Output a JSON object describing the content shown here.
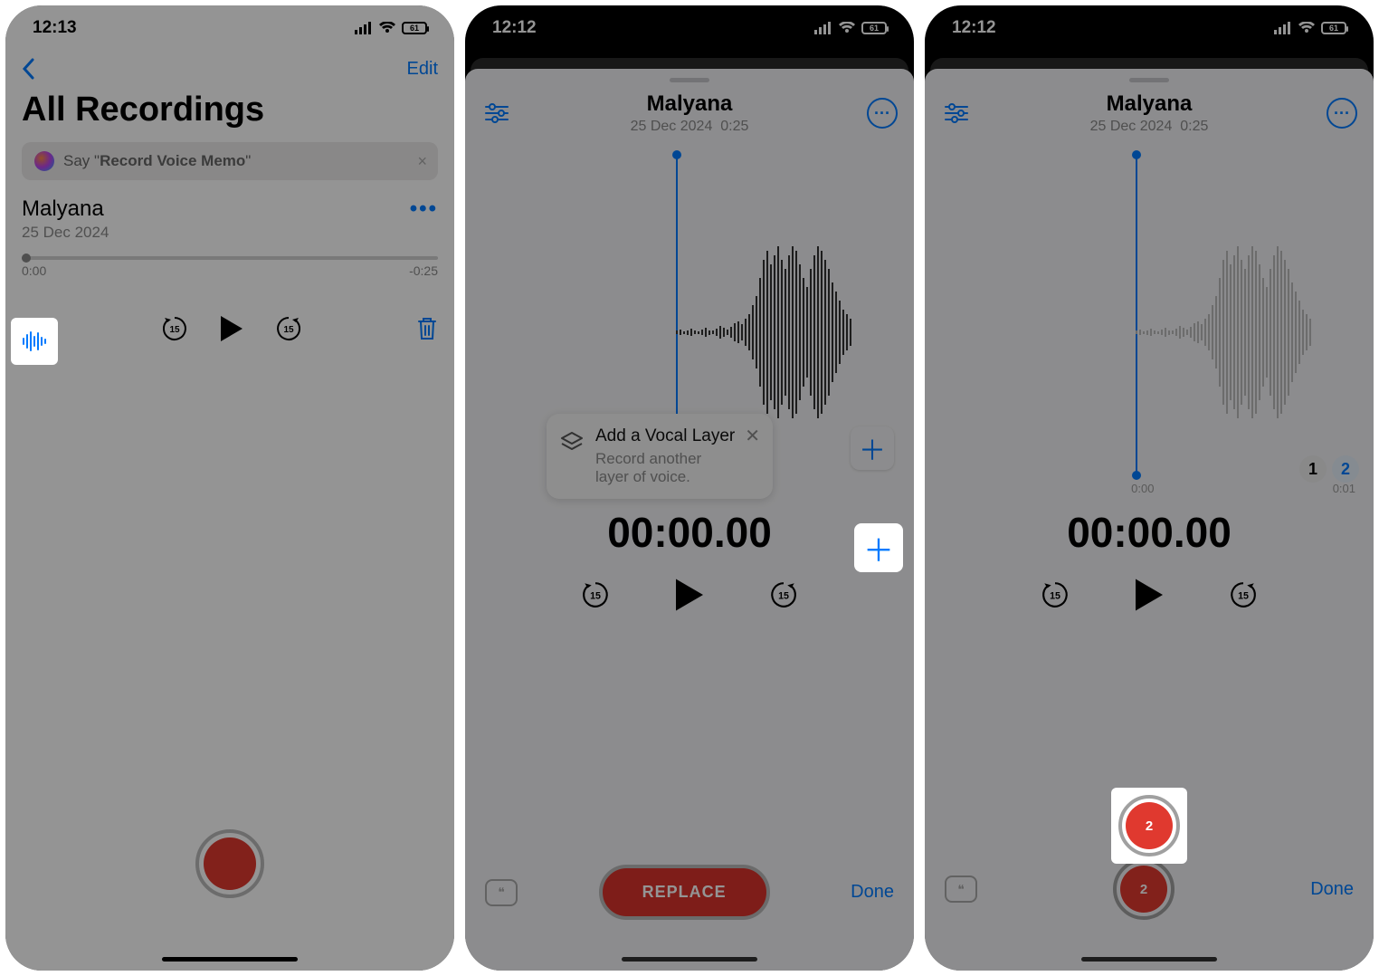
{
  "status": {
    "time1": "12:13",
    "time2": "12:12",
    "time3": "12:12",
    "battery": "61"
  },
  "screen1": {
    "edit": "Edit",
    "title": "All Recordings",
    "siri_prefix": "Say \"",
    "siri_cmd": "Record Voice Memo",
    "siri_suffix": "\"",
    "item_title": "Malyana",
    "item_date": "25 Dec 2024",
    "t_start": "0:00",
    "t_end": "-0:25"
  },
  "editor": {
    "title": "Malyana",
    "date": "25 Dec 2024",
    "dur": "0:25",
    "timer": "00:00.00",
    "tick0": "0:00",
    "tick1": "0:01",
    "replace": "REPLACE",
    "done": "Done"
  },
  "popover": {
    "title": "Add a Vocal Layer",
    "sub": "Record another layer of voice."
  },
  "layers": {
    "l1": "1",
    "l2": "2",
    "badge": "2"
  }
}
